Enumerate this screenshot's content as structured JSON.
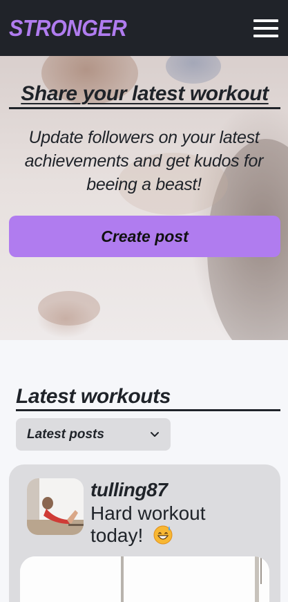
{
  "navbar": {
    "brand": "STRONGER",
    "menu_icon": "hamburger-menu-icon"
  },
  "hero": {
    "title": "Share your latest workout",
    "subtitle": "Update followers on your latest achievements and get kudos for beeing a beast!",
    "cta_label": "Create post"
  },
  "feed": {
    "section_title": "Latest workouts",
    "sort_select": {
      "selected": "Latest posts",
      "icon": "chevron-down-icon"
    },
    "posts": [
      {
        "username": "tulling87",
        "text": "Hard workout today!",
        "emoji": "grinning-sweat-emoji"
      }
    ]
  },
  "colors": {
    "navbar_bg": "#202329",
    "accent": "#b07cef",
    "page_bg": "#f6f7fa",
    "card_bg": "#dcdcdf",
    "text": "#1f2329"
  }
}
